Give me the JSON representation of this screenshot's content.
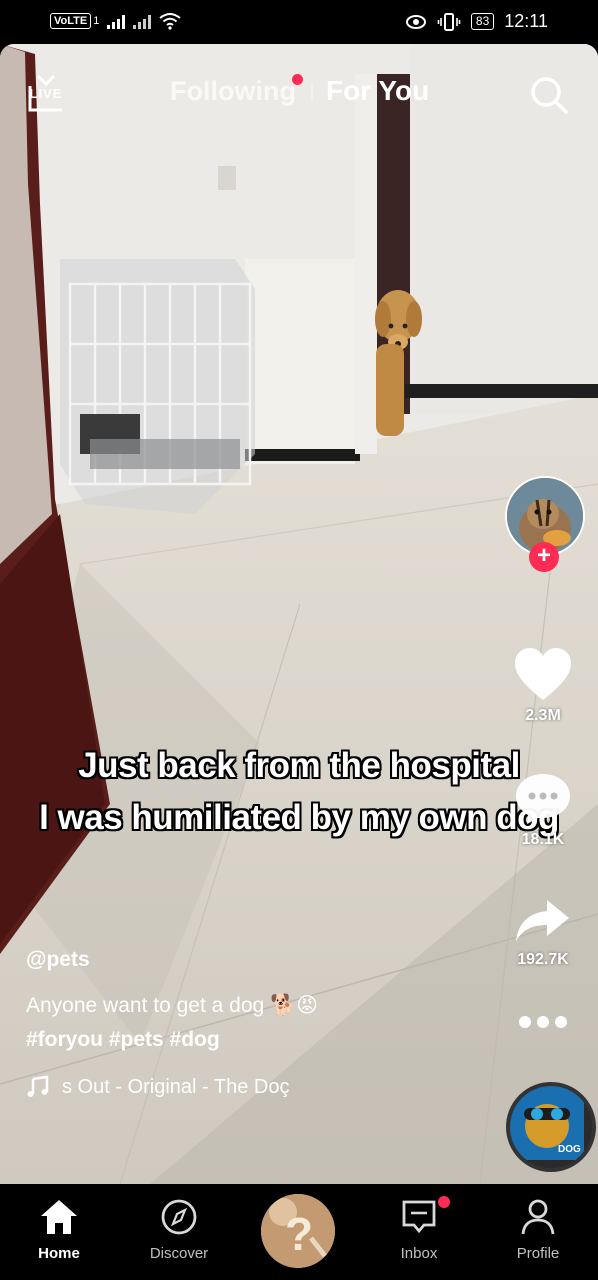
{
  "status_bar": {
    "carrier_badge": "VoLTE",
    "sim_number": "1",
    "battery": "83",
    "time": "12:11"
  },
  "top_nav": {
    "live_label": "LIVE",
    "tabs": [
      {
        "label": "Following",
        "has_badge": true
      },
      {
        "label": "For You",
        "active": true
      }
    ]
  },
  "video": {
    "caption_lines": [
      "Just back from the hospital",
      "I was humiliated by my own dog"
    ]
  },
  "actions": {
    "likes": "2.3M",
    "comments": "18.1K",
    "shares": "192.7K"
  },
  "post": {
    "username": "@pets",
    "description": "Anyone want to get a dog",
    "emojis": "🐕😡",
    "hashtags": "#foryou #pets #dog",
    "sound": "s Out - Original - The Doç",
    "disc_label": "DOG"
  },
  "bottom_nav": {
    "items": [
      {
        "label": "Home",
        "active": true
      },
      {
        "label": "Discover"
      },
      {
        "label": ""
      },
      {
        "label": "Inbox",
        "has_badge": true
      },
      {
        "label": "Profile"
      }
    ]
  },
  "colors": {
    "accent": "#fe2c55",
    "background": "#000000"
  }
}
